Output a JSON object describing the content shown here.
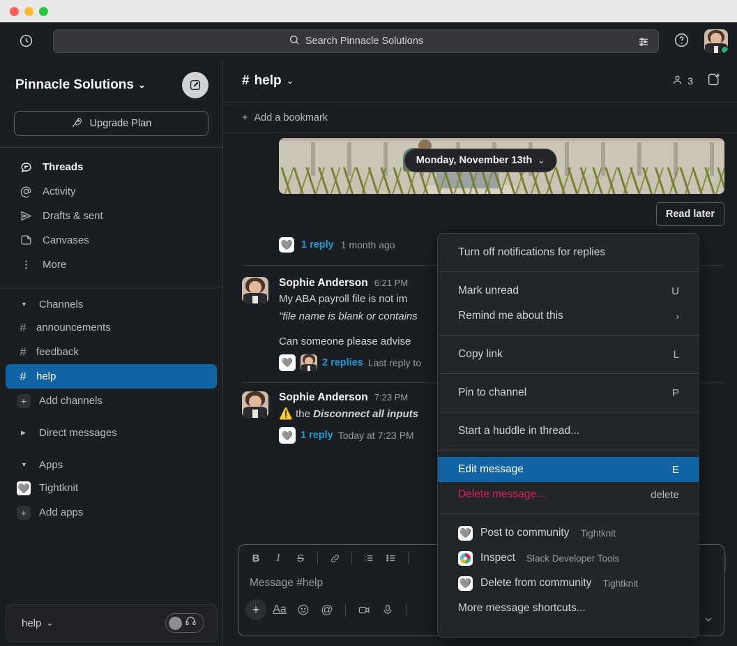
{
  "window": {
    "traffic_lights": [
      "close",
      "minimize",
      "maximize"
    ]
  },
  "topbar": {
    "history_icon": "clock-icon",
    "search": {
      "placeholder": "Search Pinnacle Solutions",
      "icon": "search-icon",
      "filter_icon": "filter-sliders-icon"
    },
    "help_icon": "question-circle-icon",
    "avatar_name": "user-avatar",
    "presence": "active"
  },
  "sidebar": {
    "workspace": "Pinnacle Solutions",
    "workspace_caret": "⌄",
    "compose_icon": "compose-pencil-icon",
    "upgrade": {
      "label": "Upgrade Plan",
      "icon": "rocket-icon"
    },
    "nav": [
      {
        "label": "Threads",
        "icon": "threads-icon",
        "bold": true
      },
      {
        "label": "Activity",
        "icon": "at-sign-icon",
        "bold": false
      },
      {
        "label": "Drafts & sent",
        "icon": "paper-plane-icon",
        "bold": false
      },
      {
        "label": "Canvases",
        "icon": "canvas-icon",
        "bold": false
      },
      {
        "label": "More",
        "icon": "more-vertical-icon",
        "bold": false
      }
    ],
    "sections": [
      {
        "title": "Channels",
        "expanded": true,
        "items": [
          {
            "label": "announcements",
            "type": "channel",
            "active": false
          },
          {
            "label": "feedback",
            "type": "channel",
            "active": false
          },
          {
            "label": "help",
            "type": "channel",
            "active": true
          },
          {
            "label": "Add channels",
            "type": "add",
            "active": false
          }
        ]
      },
      {
        "title": "Direct messages",
        "expanded": false,
        "items": []
      },
      {
        "title": "Apps",
        "expanded": true,
        "items": [
          {
            "label": "Tightknit",
            "type": "app",
            "active": false
          },
          {
            "label": "Add apps",
            "type": "add",
            "active": false
          }
        ]
      }
    ],
    "bottom": {
      "label": "help",
      "caret": "⌄",
      "toggle_icon": "headphones-icon",
      "toggle_on": false
    }
  },
  "channel": {
    "name": "help",
    "hash": "#",
    "caret": "⌄",
    "member_count": "3",
    "members_icon": "person-icon",
    "canvas_icon": "add-canvas-icon",
    "bookmark": {
      "label": "Add a bookmark",
      "icon": "plus-icon"
    }
  },
  "messages": {
    "date_divider": {
      "label": "Monday, November 13th",
      "caret": "⌄"
    },
    "read_later_label": "Read later",
    "top_thread": {
      "reply_count": "1 reply",
      "meta": "1 month ago",
      "avatar": "tightknit-app-avatar"
    },
    "items": [
      {
        "author": "Sophie Anderson",
        "time": "6:21 PM",
        "line1_plain": "My ABA payroll file is not im",
        "line2_quote": "\"file name is blank or contains",
        "line3": "Can someone please advise",
        "replies": "2 replies",
        "reply_meta": "Last reply to"
      },
      {
        "author": "Sophie Anderson",
        "time": "7:23 PM",
        "warning_icon": "warning-triangle-icon",
        "line1_prefix": "the ",
        "line1_bold": "Disconnect all inputs",
        "replies": "1 reply",
        "reply_meta": "Today at 7:23 PM"
      }
    ],
    "hover_more_icon": "more-actions-icon"
  },
  "composer": {
    "placeholder": "Message #help",
    "format_buttons": [
      {
        "name": "bold",
        "glyph": "B"
      },
      {
        "name": "italic",
        "glyph": "I"
      },
      {
        "name": "strikethrough",
        "glyph": "S"
      },
      {
        "name": "link",
        "glyph": "🔗"
      },
      {
        "name": "ordered-list",
        "glyph": "1."
      },
      {
        "name": "bulleted-list",
        "glyph": "•"
      }
    ],
    "action_buttons": [
      {
        "name": "plus",
        "glyph": "+"
      },
      {
        "name": "formatting",
        "glyph": "Aa"
      },
      {
        "name": "emoji",
        "glyph": "☺"
      },
      {
        "name": "mention",
        "glyph": "@"
      },
      {
        "name": "video",
        "glyph": "▭"
      },
      {
        "name": "audio",
        "glyph": "🎙"
      }
    ],
    "caret_icon": "chevron-down-icon"
  },
  "context_menu": {
    "groups": [
      {
        "items": [
          {
            "label": "Turn off notifications for replies",
            "shortcut": "",
            "state": "normal"
          }
        ]
      },
      {
        "items": [
          {
            "label": "Mark unread",
            "shortcut": "U",
            "state": "normal"
          },
          {
            "label": "Remind me about this",
            "shortcut": "›",
            "state": "submenu"
          }
        ]
      },
      {
        "items": [
          {
            "label": "Copy link",
            "shortcut": "L",
            "state": "normal"
          }
        ]
      },
      {
        "items": [
          {
            "label": "Pin to channel",
            "shortcut": "P",
            "state": "normal"
          }
        ]
      },
      {
        "items": [
          {
            "label": "Start a huddle in thread...",
            "shortcut": "",
            "state": "normal"
          }
        ]
      },
      {
        "items": [
          {
            "label": "Edit message",
            "shortcut": "E",
            "state": "highlight"
          },
          {
            "label": "Delete message...",
            "shortcut": "delete",
            "state": "danger"
          }
        ]
      },
      {
        "items": [
          {
            "label": "Post to community",
            "sublabel": "Tightknit",
            "icon": "tightknit-app-icon",
            "shortcut": "",
            "state": "normal"
          },
          {
            "label": "Inspect",
            "sublabel": "Slack Developer Tools",
            "icon": "inspect-app-icon",
            "shortcut": "",
            "state": "normal"
          },
          {
            "label": "Delete from community",
            "sublabel": "Tightknit",
            "icon": "tightknit-app-icon",
            "shortcut": "",
            "state": "normal"
          },
          {
            "label": "More message shortcuts...",
            "shortcut": "",
            "state": "normal"
          }
        ]
      }
    ]
  },
  "colors": {
    "accent_blue": "#1164a3",
    "danger_red": "#e01e5a",
    "link_blue": "#1d9bd1",
    "bg": "#1a1d21",
    "menu_bg": "#222529"
  }
}
